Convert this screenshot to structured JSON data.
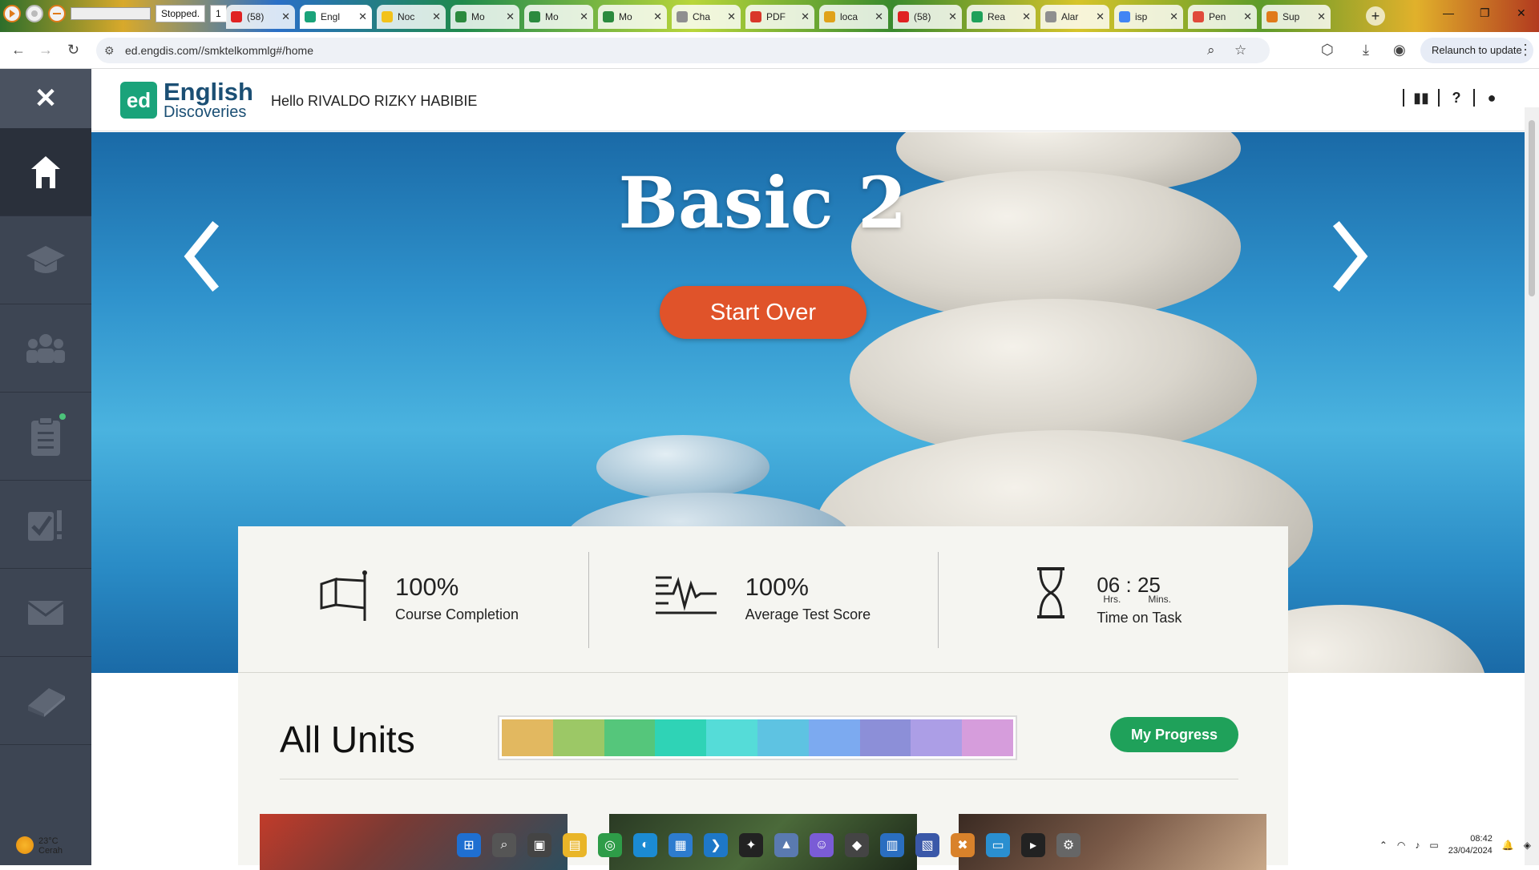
{
  "browser": {
    "left_tools": {
      "status_text": "Stopped.",
      "count": "1"
    },
    "tabs": [
      {
        "title": "(58)",
        "fav": "#e02222"
      },
      {
        "title": "Engl",
        "fav": "#1aa37a",
        "active": true
      },
      {
        "title": "Noc",
        "fav": "#f2c21a"
      },
      {
        "title": "Mo",
        "fav": "#2b8a3e"
      },
      {
        "title": "Mo",
        "fav": "#2b8a3e"
      },
      {
        "title": "Mo",
        "fav": "#2b8a3e"
      },
      {
        "title": "Cha",
        "fav": "#8f8f8f"
      },
      {
        "title": "PDF",
        "fav": "#d9372a"
      },
      {
        "title": "loca",
        "fav": "#e0a21a"
      },
      {
        "title": "(58)",
        "fav": "#e02222"
      },
      {
        "title": "Rea",
        "fav": "#1fa15a"
      },
      {
        "title": "Alar",
        "fav": "#8f8f8f"
      },
      {
        "title": "isp",
        "fav": "#4285f4"
      },
      {
        "title": "Pen",
        "fav": "#e04a3a"
      },
      {
        "title": "Sup",
        "fav": "#e07a1a"
      }
    ],
    "url": "ed.engdis.com//smktelkommlg#/home",
    "relaunch": "Relaunch to update"
  },
  "sidebar": {
    "close_icon": "close-icon",
    "items": [
      {
        "name": "home",
        "icon": "home-icon",
        "active": true
      },
      {
        "name": "courses",
        "icon": "graduation-cap-icon"
      },
      {
        "name": "community",
        "icon": "group-icon"
      },
      {
        "name": "assignments",
        "icon": "clipboard-icon",
        "notify": true
      },
      {
        "name": "tests",
        "icon": "checklist-icon"
      },
      {
        "name": "messages",
        "icon": "mail-icon"
      },
      {
        "name": "dictionary",
        "icon": "book-icon"
      }
    ]
  },
  "header": {
    "logo_mark": "ed",
    "logo_line1": "English",
    "logo_line2": "Discoveries",
    "greeting": "Hello RIVALDO RIZKY HABIBIE"
  },
  "hero": {
    "title": "Basic 2",
    "button": "Start Over"
  },
  "stats": {
    "completion_value": "100%",
    "completion_label": "Course Completion",
    "score_value": "100%",
    "score_label": "Average Test Score",
    "time_hours": "06",
    "time_sep": ":",
    "time_minutes": "25",
    "hrs_label": "Hrs.",
    "mins_label": "Mins.",
    "time_label": "Time on Task"
  },
  "units": {
    "title": "All Units",
    "button": "My Progress",
    "bar_colors": [
      "#e2b860",
      "#9cc866",
      "#55c67b",
      "#2fd3b6",
      "#55dcd8",
      "#5ec3e2",
      "#7caaf0",
      "#8c8fd8",
      "#ac9ee6",
      "#d69ddc"
    ]
  },
  "taskbar": {
    "temp": "23°C",
    "cond": "Cerah",
    "time": "08:42",
    "date": "23/04/2024"
  }
}
